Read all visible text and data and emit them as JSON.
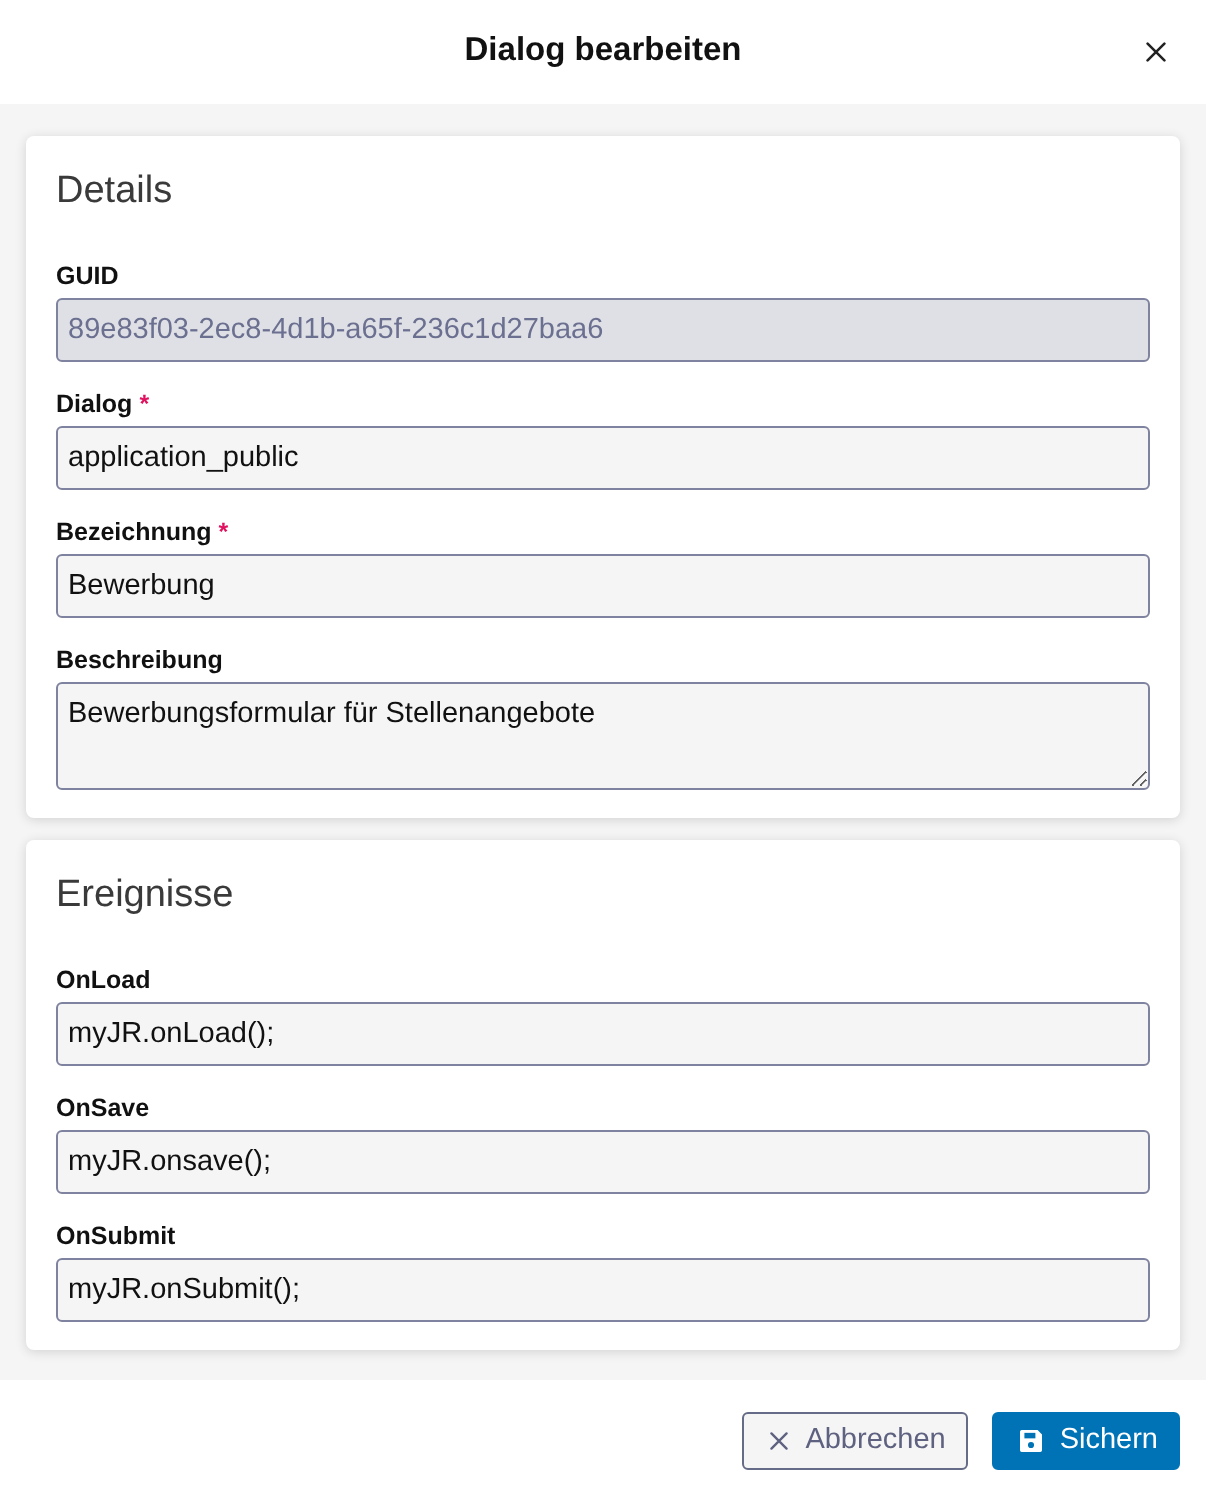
{
  "dialog": {
    "title": "Dialog bearbeiten"
  },
  "sections": [
    {
      "title": "Details",
      "fields": [
        {
          "label": "GUID",
          "kind": "input",
          "disabled": true,
          "value": "89e83f03-2ec8-4d1b-a65f-236c1d27baa6"
        },
        {
          "label": "Dialog",
          "required_mark": "*",
          "kind": "input",
          "disabled": false,
          "value": "application_public"
        },
        {
          "label": "Bezeichnung",
          "required_mark": "*",
          "kind": "input",
          "disabled": false,
          "value": "Bewerbung"
        },
        {
          "label": "Beschreibung",
          "kind": "textarea",
          "disabled": false,
          "value": "Bewerbungsformular für Stellenangebote"
        }
      ]
    },
    {
      "title": "Ereignisse",
      "fields": [
        {
          "label": "OnLoad",
          "kind": "input",
          "disabled": false,
          "value": "myJR.onLoad();"
        },
        {
          "label": "OnSave",
          "kind": "input",
          "disabled": false,
          "value": "myJR.onsave();"
        },
        {
          "label": "OnSubmit",
          "kind": "input",
          "disabled": false,
          "value": "myJR.onSubmit();"
        }
      ]
    }
  ],
  "buttons": [
    {
      "label": "Abbrechen",
      "kind": "cancel"
    },
    {
      "label": "Sichern",
      "kind": "save"
    }
  ]
}
